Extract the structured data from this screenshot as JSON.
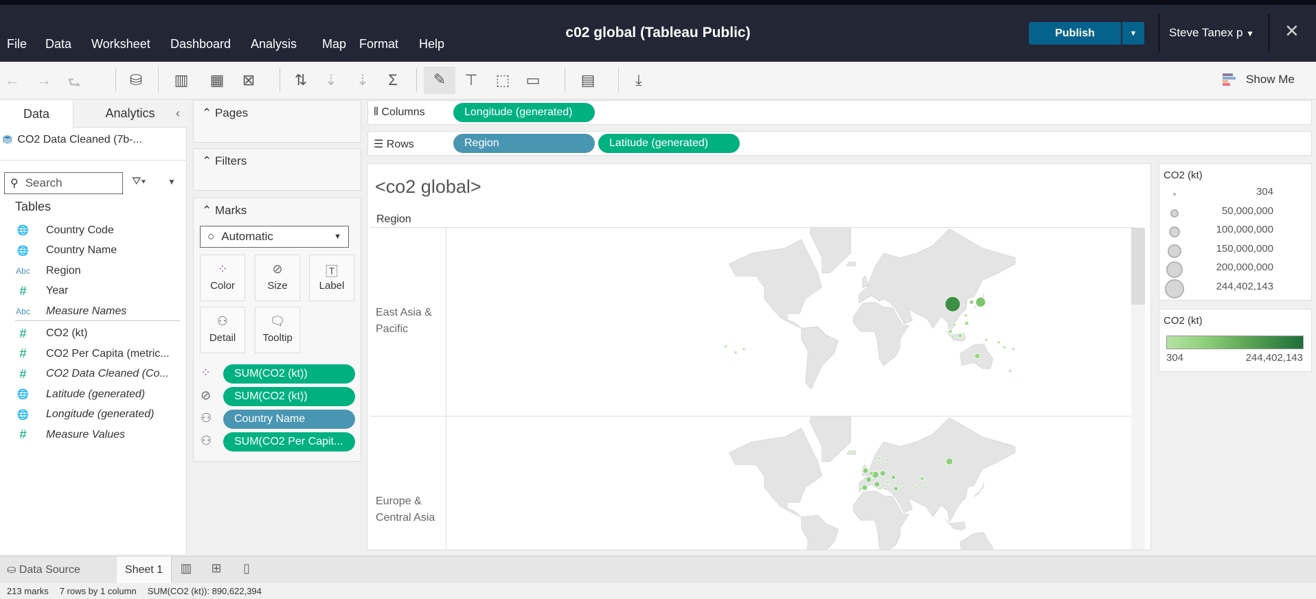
{
  "app": {
    "title": "c02 global (Tableau Public)",
    "publish": "Publish",
    "user": "Steve Tanex p",
    "menu": [
      "File",
      "Data",
      "Worksheet",
      "Dashboard",
      "Analysis",
      "Map",
      "Format",
      "Help"
    ]
  },
  "toolbar": {
    "show_me": "Show Me"
  },
  "left": {
    "tabs": [
      "Data",
      "Analytics"
    ],
    "datasource": "CO2 Data Cleaned (7b-...",
    "search_placeholder": "Search",
    "tables_heading": "Tables",
    "fields": [
      {
        "icon": "globe",
        "label": "Country Code",
        "italic": false
      },
      {
        "icon": "globe",
        "label": "Country Name",
        "italic": false
      },
      {
        "icon": "abc",
        "label": "Region",
        "italic": false
      },
      {
        "icon": "number",
        "label": "Year",
        "italic": false
      },
      {
        "icon": "abc",
        "label": "Measure Names",
        "italic": true
      },
      {
        "icon": "number",
        "label": "CO2 (kt)",
        "italic": false
      },
      {
        "icon": "number",
        "label": "CO2 Per Capita (metric...",
        "italic": false
      },
      {
        "icon": "number",
        "label": "CO2 Data Cleaned (Co...",
        "italic": true
      },
      {
        "icon": "globe",
        "label": "Latitude (generated)",
        "italic": true
      },
      {
        "icon": "globe",
        "label": "Longitude (generated)",
        "italic": true
      },
      {
        "icon": "number",
        "label": "Measure Values",
        "italic": true
      }
    ]
  },
  "cards": {
    "pages": "Pages",
    "filters": "Filters",
    "marks": "Marks",
    "mark_type": "Automatic",
    "buttons": [
      "Color",
      "Size",
      "Label",
      "Detail",
      "Tooltip"
    ],
    "encodings": [
      {
        "icon": "color",
        "label": "SUM(CO2 (kt))",
        "kind": "measure"
      },
      {
        "icon": "size",
        "label": "SUM(CO2 (kt))",
        "kind": "measure"
      },
      {
        "icon": "detail",
        "label": "Country Name",
        "kind": "dimension"
      },
      {
        "icon": "detail",
        "label": "SUM(CO2 Per Capit...",
        "kind": "measure"
      }
    ]
  },
  "shelves": {
    "columns_label": "Columns",
    "rows_label": "Rows",
    "columns": [
      "Longitude (generated)"
    ],
    "rows": [
      "Region",
      "Latitude (generated)"
    ]
  },
  "viz": {
    "title": "<co2 global>",
    "row_header": "Region",
    "rows": [
      "East Asia & Pacific",
      "Europe & Central Asia"
    ]
  },
  "legends": {
    "size": {
      "title": "CO2 (kt)",
      "items": [
        "304",
        "50,000,000",
        "100,000,000",
        "150,000,000",
        "200,000,000",
        "244,402,143"
      ]
    },
    "color": {
      "title": "CO2 (kt)",
      "min": "304",
      "max": "244,402,143",
      "colors": [
        "#b5e3a5",
        "#1f6e3a"
      ]
    }
  },
  "bottom": {
    "data_source": "Data Source",
    "sheet": "Sheet 1"
  },
  "status": {
    "marks": "213 marks",
    "dims": "7 rows by 1 column",
    "sum": "SUM(CO2 (kt)): 890,622,394"
  }
}
